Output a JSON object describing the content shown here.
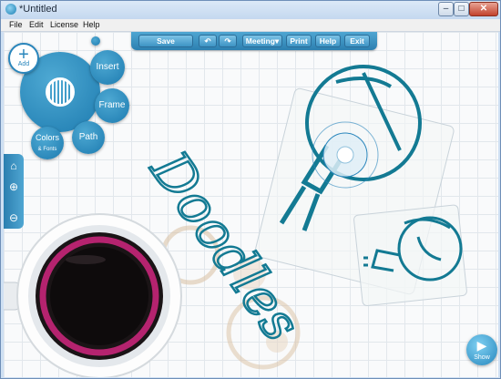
{
  "window": {
    "title": "*Untitled",
    "min": "–",
    "max": "□",
    "close": "✕"
  },
  "menu": [
    "File",
    "Edit",
    "License",
    "Help"
  ],
  "toolbar": {
    "save": "Save",
    "undo": "↶",
    "redo": "↷",
    "meeting": "Meeting",
    "meeting_caret": "▾",
    "print": "Print",
    "help": "Help",
    "exit": "Exit"
  },
  "radial_menu": {
    "add": "Add",
    "plus": "+",
    "insert": "Insert",
    "frame": "Frame",
    "path": "Path",
    "colors": "Colors",
    "colors_sub": "& Fonts"
  },
  "side_tools": {
    "home": "⌂",
    "zoom_in": "⊕",
    "zoom_out": "⊖"
  },
  "canvas_text": {
    "doodle": "Doodles"
  },
  "show": {
    "play": "▶",
    "label": "Show"
  },
  "colors": {
    "accent": "#2a86bc",
    "ink": "#137a93",
    "cup_rim": "#b5236f",
    "coffee": "#1a1416"
  }
}
